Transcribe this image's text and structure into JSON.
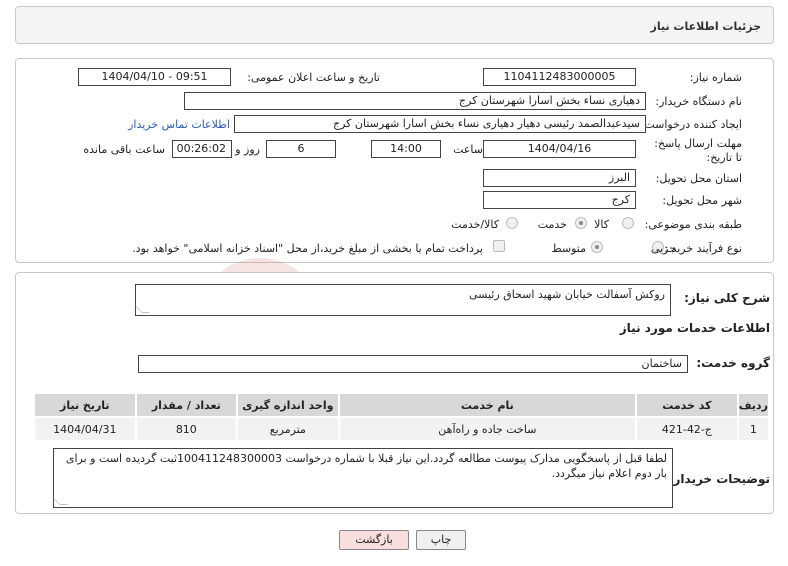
{
  "header": {
    "title": "جزئیات اطلاعات نیاز"
  },
  "form": {
    "need_number_label": "شماره نیاز:",
    "need_number": "1104112483000005",
    "announce_label": "تاریخ و ساعت اعلان عمومی:",
    "announce_value": "1404/04/10 - 09:51",
    "buyer_org_label": "نام دستگاه خریدار:",
    "buyer_org": "دهیاری نساء بخش اسارا شهرستان کرج",
    "creator_label": "ایجاد کننده درخواست:",
    "creator": "سیدعبدالصمد رئیسی دهیار دهیاری نساء بخش اسارا شهرستان کرج",
    "contact_link": "اطلاعات تماس خریدار",
    "deadline_label": "مهلت ارسال پاسخ: تا تاریخ:",
    "deadline_date": "1404/04/16",
    "time_label": "ساعت",
    "deadline_time": "14:00",
    "days_value": "6",
    "days_label": "روز و",
    "remaining_time": "00:26:02",
    "remaining_label": "ساعت باقی مانده",
    "province_label": "استان محل تحویل:",
    "province": "البرز",
    "city_label": "شهر محل تحویل:",
    "city": "کرج",
    "category_label": "طبقه بندی موضوعی:",
    "category_options": [
      "کالا",
      "خدمت",
      "کالا/خدمت"
    ],
    "process_label": "نوع فرآیند خرید :",
    "process_options": [
      "جزیی",
      "متوسط"
    ],
    "payment_note": "پرداخت تمام یا بخشی از مبلغ خرید،از محل \"اسناد خزانه اسلامی\" خواهد بود."
  },
  "summary": {
    "label": "شرح کلی نیاز:",
    "value": "روکش آسفالت خیابان شهید اسحاق رئیسی"
  },
  "services_info": {
    "title": "اطلاعات خدمات مورد نیاز",
    "group_label": "گروه خدمت:",
    "group_value": "ساختمان"
  },
  "table": {
    "headers": [
      "ردیف",
      "کد خدمت",
      "نام خدمت",
      "واحد اندازه گیری",
      "تعداد / مقدار",
      "تاریخ نیاز"
    ],
    "rows": [
      [
        "1",
        "ج-42-421",
        "ساخت جاده و راه‌آهن",
        "مترمربع",
        "810",
        "1404/04/31"
      ]
    ]
  },
  "notes": {
    "label": "توضیحات خریدار:",
    "value": "لطفا قبل از پاسخگویی مدارک پیوست مطالعه گردد.این نیاز قبلا با شماره درخواست 100411248300003ثبت گردیده است و برای بار دوم اعلام نیاز میگردد."
  },
  "buttons": {
    "print": "چاپ",
    "back": "بازگشت"
  },
  "watermark_text": "AriaTender.neT",
  "colors": {
    "link": "#2a5bbd",
    "back_button": "#f9dede",
    "table_header": "#d8d8d8"
  }
}
